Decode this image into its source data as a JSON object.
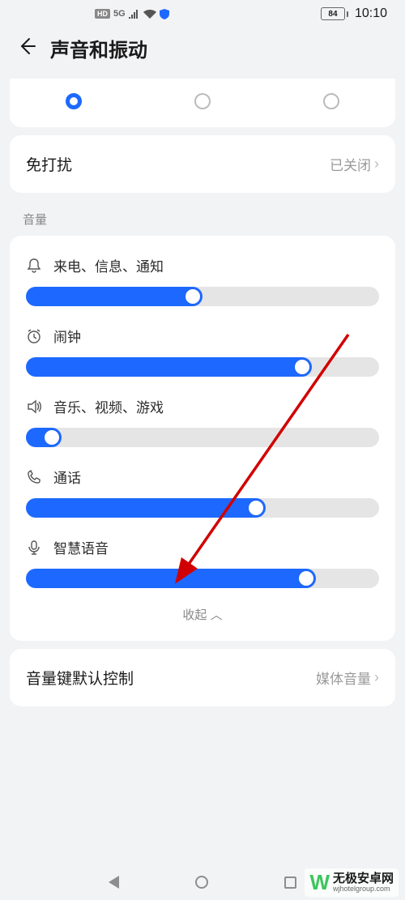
{
  "status": {
    "hd": "HD",
    "net": "5G",
    "battery_pct": "84",
    "time": "10:10"
  },
  "header": {
    "title": "声音和振动"
  },
  "modes": {
    "count": 3,
    "selected_index": 0
  },
  "dnd": {
    "label": "免打扰",
    "value": "已关闭"
  },
  "section_volume_title": "音量",
  "volume": [
    {
      "icon": "bell",
      "label": "来电、信息、通知",
      "percent": 50
    },
    {
      "icon": "alarm",
      "label": "闹钟",
      "percent": 81
    },
    {
      "icon": "speaker",
      "label": "音乐、视频、游戏",
      "percent": 10
    },
    {
      "icon": "phone",
      "label": "通话",
      "percent": 68
    },
    {
      "icon": "mic",
      "label": "智慧语音",
      "percent": 82
    }
  ],
  "collapse": {
    "label": "收起"
  },
  "vol_key": {
    "label": "音量键默认控制",
    "value": "媒体音量"
  },
  "watermark": {
    "zh": "无极安卓网",
    "en": "wjhotelgroup.com"
  }
}
